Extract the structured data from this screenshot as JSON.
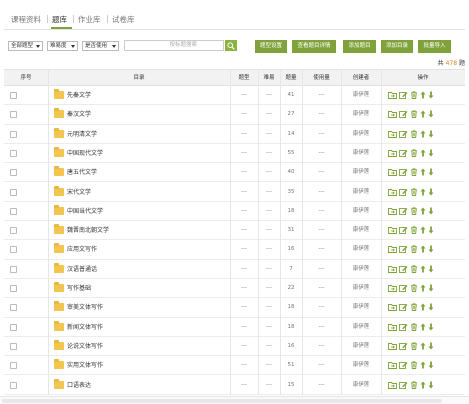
{
  "tabs": [
    {
      "label": "课程资料",
      "active": false
    },
    {
      "label": "题库",
      "active": true
    },
    {
      "label": "作业库",
      "active": false
    },
    {
      "label": "试卷库",
      "active": false
    }
  ],
  "filters": {
    "type": "全部题型",
    "difficulty": "难易度",
    "usage": "是否使用",
    "search_placeholder": "按标题搜索"
  },
  "toolbar": {
    "type_settings": "题型设置",
    "view_details": "查看题目详情",
    "add_question": "添加题目",
    "add_directory": "添加目录",
    "batch_import": "批量导入"
  },
  "summary": {
    "prefix": "共",
    "count": "478",
    "suffix": "题"
  },
  "columns": {
    "seq": "序号",
    "directory": "目录",
    "type": "题型",
    "difficulty": "难易",
    "count": "题量",
    "usage": "使用量",
    "creator": "创建者",
    "ops": "操作"
  },
  "rows": [
    {
      "title": "先秦文学",
      "type": "---",
      "difficulty": "---",
      "count": "41",
      "usage": "---",
      "creator": "康伊莲"
    },
    {
      "title": "秦汉文学",
      "type": "---",
      "difficulty": "---",
      "count": "27",
      "usage": "---",
      "creator": "康伊莲"
    },
    {
      "title": "元明清文学",
      "type": "---",
      "difficulty": "---",
      "count": "14",
      "usage": "---",
      "creator": "康伊莲"
    },
    {
      "title": "中国现代文学",
      "type": "---",
      "difficulty": "---",
      "count": "55",
      "usage": "---",
      "creator": "康伊莲"
    },
    {
      "title": "唐五代文学",
      "type": "---",
      "difficulty": "---",
      "count": "40",
      "usage": "---",
      "creator": "康伊莲"
    },
    {
      "title": "宋代文学",
      "type": "---",
      "difficulty": "---",
      "count": "35",
      "usage": "---",
      "creator": "康伊莲"
    },
    {
      "title": "中国当代文学",
      "type": "---",
      "difficulty": "---",
      "count": "18",
      "usage": "---",
      "creator": "康伊莲"
    },
    {
      "title": "魏晋南北朝文学",
      "type": "---",
      "difficulty": "---",
      "count": "31",
      "usage": "---",
      "creator": "康伊莲"
    },
    {
      "title": "应用文写作",
      "type": "---",
      "difficulty": "---",
      "count": "16",
      "usage": "---",
      "creator": "康伊莲"
    },
    {
      "title": "汉语普通话",
      "type": "---",
      "difficulty": "---",
      "count": "7",
      "usage": "---",
      "creator": "康伊莲"
    },
    {
      "title": "写作基础",
      "type": "---",
      "difficulty": "---",
      "count": "22",
      "usage": "---",
      "creator": "康伊莲"
    },
    {
      "title": "审美文体写作",
      "type": "---",
      "difficulty": "---",
      "count": "18",
      "usage": "---",
      "creator": "康伊莲"
    },
    {
      "title": "新闻文体写作",
      "type": "---",
      "difficulty": "---",
      "count": "18",
      "usage": "---",
      "creator": "康伊莲"
    },
    {
      "title": "论说文体写作",
      "type": "---",
      "difficulty": "---",
      "count": "16",
      "usage": "---",
      "creator": "康伊莲"
    },
    {
      "title": "实用文体写作",
      "type": "---",
      "difficulty": "---",
      "count": "51",
      "usage": "---",
      "creator": "康伊莲"
    },
    {
      "title": "口语表达",
      "type": "---",
      "difficulty": "---",
      "count": "15",
      "usage": "---",
      "creator": "康伊莲"
    }
  ],
  "colors": {
    "accent": "#7fa33a",
    "count_highlight": "#e57c1f",
    "folder": "#f2c64e"
  },
  "op_icons": [
    "move-to-icon",
    "edit-icon",
    "delete-icon",
    "move-up-icon",
    "move-down-icon"
  ]
}
